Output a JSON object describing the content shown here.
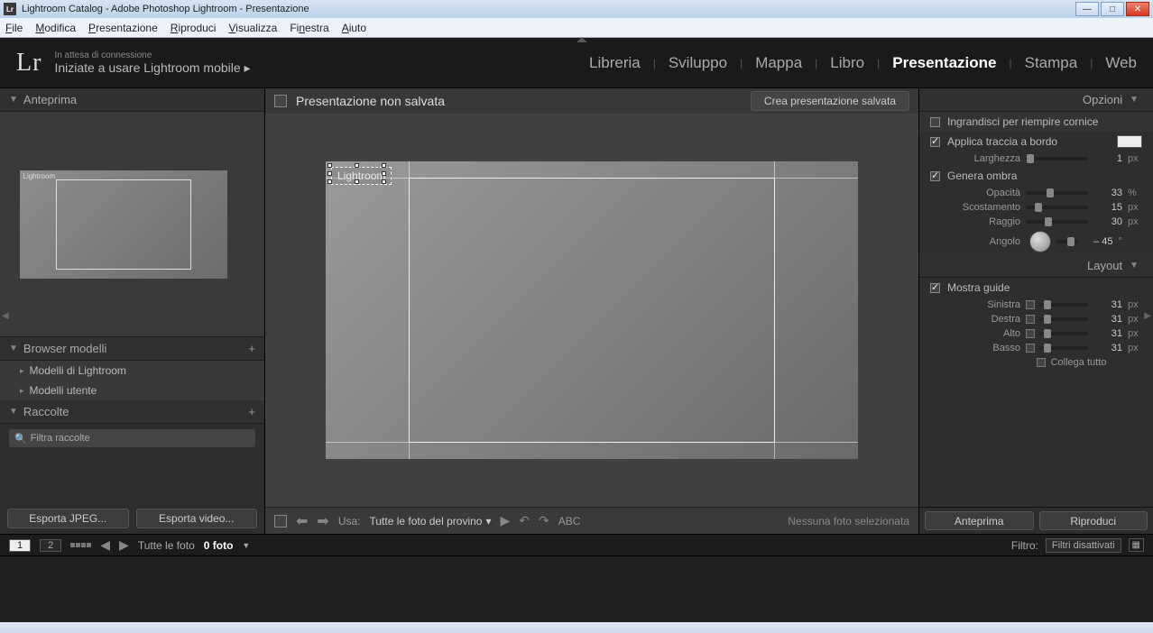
{
  "window": {
    "title": "Lightroom Catalog - Adobe Photoshop Lightroom - Presentazione",
    "app_badge": "Lr"
  },
  "menu": {
    "file": "File",
    "edit": "Modifica",
    "slideshow": "Presentazione",
    "play": "Riproduci",
    "view": "Visualizza",
    "window": "Finestra",
    "help": "Aiuto"
  },
  "header": {
    "logo": "Lr",
    "connection_status": "In attesa di connessione",
    "mobile_prompt": "Iniziate a usare Lightroom mobile  ▸",
    "modules": {
      "library": "Libreria",
      "develop": "Sviluppo",
      "map": "Mappa",
      "book": "Libro",
      "slideshow": "Presentazione",
      "print": "Stampa",
      "web": "Web"
    }
  },
  "left": {
    "preview_header": "Anteprima",
    "preview_watermark": "Lightroom",
    "template_browser_header": "Browser modelli",
    "templates": {
      "lightroom": "Modelli di Lightroom",
      "user": "Modelli utente"
    },
    "collections_header": "Raccolte",
    "filter_placeholder": "Filtra raccolte",
    "export_jpeg": "Esporta JPEG...",
    "export_video": "Esporta video..."
  },
  "center": {
    "title": "Presentazione non salvata",
    "save_button": "Crea presentazione salvata",
    "slide_text": "Lightroom",
    "usa_label": "Usa:",
    "usa_value": "Tutte le foto del provino",
    "abc_label": "ABC",
    "selection_status": "Nessuna foto selezionata"
  },
  "right": {
    "options_header": "Opzioni",
    "zoom_to_fill": "Ingrandisci per riempire cornice",
    "stroke_border": "Applica traccia a bordo",
    "width_label": "Larghezza",
    "width_value": "1",
    "width_unit": "px",
    "cast_shadow": "Genera ombra",
    "opacity_label": "Opacità",
    "opacity_value": "33",
    "opacity_unit": "%",
    "offset_label": "Scostamento",
    "offset_value": "15",
    "offset_unit": "px",
    "radius_label": "Raggio",
    "radius_value": "30",
    "radius_unit": "px",
    "angle_label": "Angolo",
    "angle_value": "– 45",
    "angle_unit": "°",
    "layout_header": "Layout",
    "show_guides": "Mostra guide",
    "left_label": "Sinistra",
    "right_label": "Destra",
    "top_label": "Alto",
    "bottom_label": "Basso",
    "guide_value": "31",
    "guide_unit": "px",
    "link_all": "Collega tutto",
    "preview_btn": "Anteprima",
    "play_btn": "Riproduci"
  },
  "filmstrip": {
    "page1": "1",
    "page2": "2",
    "all_photos": "Tutte le foto",
    "count": "0 foto",
    "filter_label": "Filtro:",
    "filter_value": "Filtri disattivati"
  }
}
